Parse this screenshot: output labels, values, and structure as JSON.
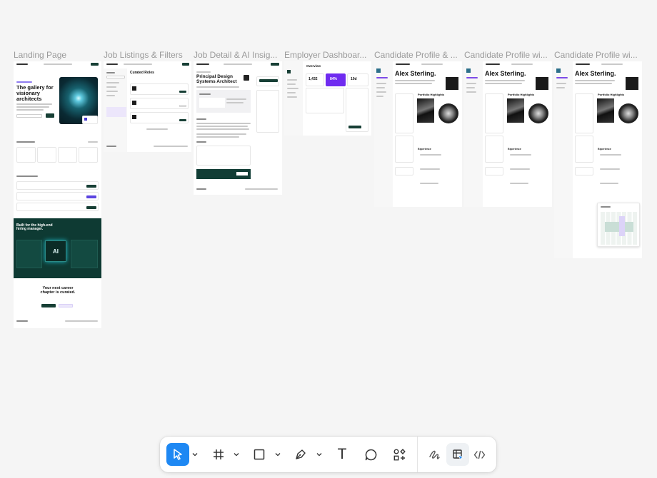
{
  "frames": [
    {
      "label": "Landing Page"
    },
    {
      "label": "Job Listings & Filters"
    },
    {
      "label": "Job Detail & AI Insig..."
    },
    {
      "label": "Employer Dashboar..."
    },
    {
      "label": "Candidate Profile & ..."
    },
    {
      "label": "Candidate Profile wi..."
    },
    {
      "label": "Candidate Profile wi..."
    }
  ],
  "landing": {
    "hero_title": "The gallery for visionary architects",
    "section_title": "Built for the high-end hiring manager.",
    "ai_text": "AI",
    "cta_title": "Your next career chapter is curated."
  },
  "listings": {
    "title": "Curated Roles"
  },
  "detail": {
    "title": "Principal Design Systems Architect"
  },
  "dashboard": {
    "title": "Overview",
    "stat1": "1,432",
    "stat2": "84%",
    "stat3": "10d"
  },
  "profiles": [
    {
      "name": "Alex Sterling.",
      "section": "Portfolio Highlights",
      "experience": "Experience"
    },
    {
      "name": "Alex Sterling.",
      "section": "Portfolio Highlights",
      "experience": "Experience"
    },
    {
      "name": "Alex Sterling.",
      "section": "Portfolio Highlights",
      "experience": "Experience"
    }
  ],
  "toolbar": {
    "colors": {
      "active": "#1e88f3",
      "icon": "#333333"
    },
    "tools": [
      {
        "name": "move-tool",
        "icon": "cursor-arrow-icon",
        "active": true
      },
      {
        "name": "frame-tool",
        "icon": "hash-frame-icon"
      },
      {
        "name": "shape-tool",
        "icon": "square-icon"
      },
      {
        "name": "pen-tool",
        "icon": "pen-nib-icon"
      },
      {
        "name": "text-tool",
        "icon": "text-t-icon",
        "glyph": "T"
      },
      {
        "name": "comment-tool",
        "icon": "speech-bubble-icon"
      },
      {
        "name": "actions-tool",
        "icon": "shapes-plus-icon"
      },
      {
        "name": "draw-mode",
        "icon": "scribble-icon"
      },
      {
        "name": "design-mode",
        "icon": "design-pointer-icon",
        "selected": true
      },
      {
        "name": "dev-mode",
        "icon": "code-brackets-icon"
      }
    ]
  }
}
